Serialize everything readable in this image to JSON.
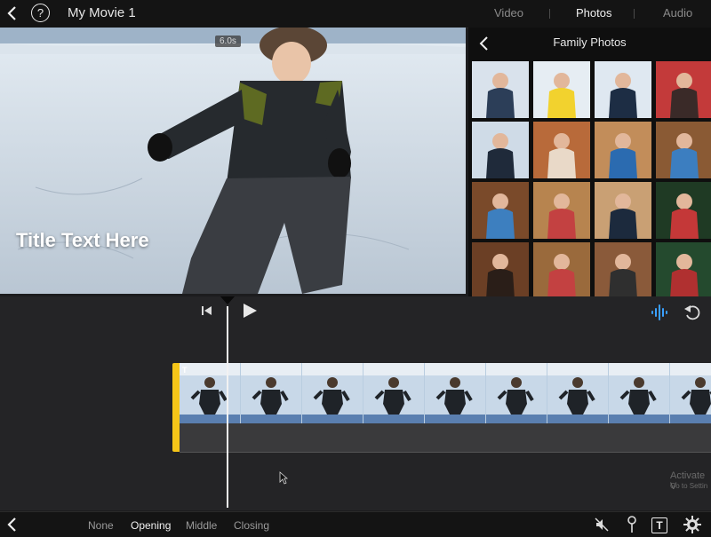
{
  "top_bar": {
    "project_title": "My Movie 1",
    "help_label": "?",
    "tabs": [
      {
        "label": "Video",
        "active": false
      },
      {
        "label": "Photos",
        "active": true
      },
      {
        "label": "Audio",
        "active": false
      }
    ]
  },
  "viewer": {
    "duration_badge": "6.0s",
    "title_overlay": "Title Text Here"
  },
  "browser": {
    "album_title": "Family Photos",
    "photo_count": 16
  },
  "timeline": {
    "clip_title_marker": "T",
    "watermark_line1": "Activate V",
    "watermark_line2": "Go to Settin"
  },
  "bottom_bar": {
    "title_styles": [
      {
        "label": "None",
        "active": false
      },
      {
        "label": "Opening",
        "active": true
      },
      {
        "label": "Middle",
        "active": false
      },
      {
        "label": "Closing",
        "active": false
      }
    ],
    "title_tool_label": "T"
  },
  "colors": {
    "accent_yellow": "#f5c518",
    "audio_blue": "#3aa0ff"
  }
}
